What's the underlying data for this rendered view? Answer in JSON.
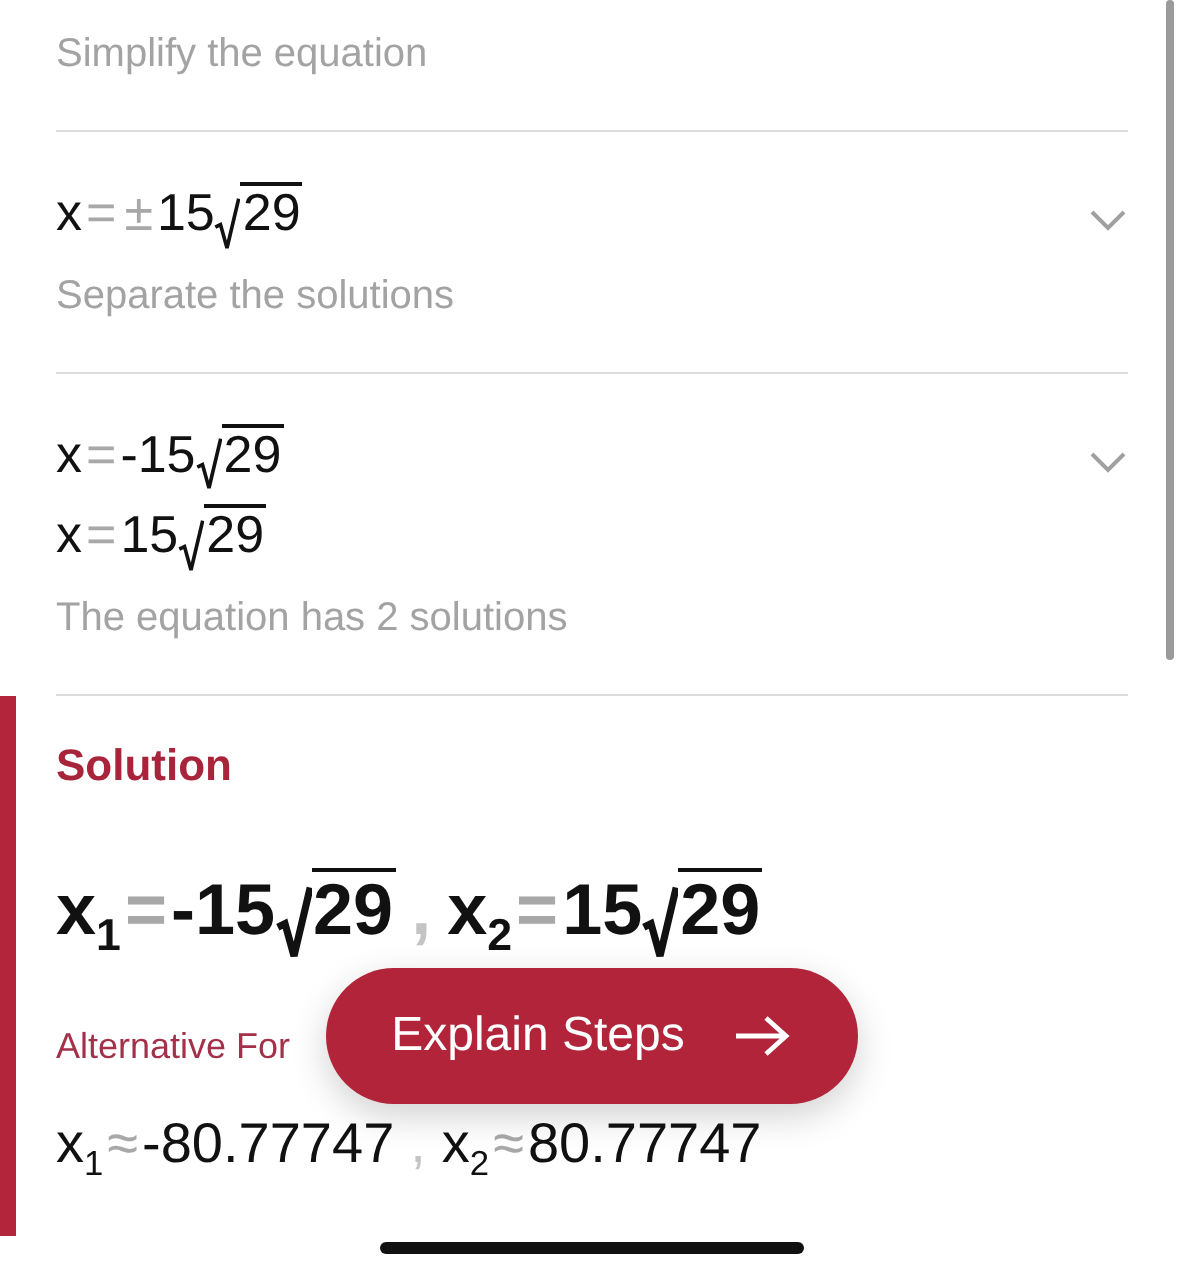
{
  "steps": [
    {
      "caption": "Simplify the equation"
    },
    {
      "expressions": [
        [
          {
            "kind": "var",
            "text": "x"
          },
          {
            "kind": "op",
            "text": "="
          },
          {
            "kind": "op",
            "text": "±"
          },
          {
            "kind": "num",
            "text": "15"
          },
          {
            "kind": "sqrt",
            "text": "29"
          }
        ]
      ],
      "caption": "Separate the solutions",
      "expanded": false
    },
    {
      "expressions": [
        [
          {
            "kind": "var",
            "text": "x"
          },
          {
            "kind": "op",
            "text": "="
          },
          {
            "kind": "num",
            "text": "-15"
          },
          {
            "kind": "sqrt",
            "text": "29"
          }
        ],
        [
          {
            "kind": "var",
            "text": "x"
          },
          {
            "kind": "op",
            "text": "="
          },
          {
            "kind": "num",
            "text": "15"
          },
          {
            "kind": "sqrt",
            "text": "29"
          }
        ]
      ],
      "caption": "The equation has 2 solutions",
      "expanded": false
    }
  ],
  "solution": {
    "title": "Solution",
    "expression": [
      {
        "kind": "var",
        "text": "x",
        "sub": "1"
      },
      {
        "kind": "op",
        "text": "="
      },
      {
        "kind": "num",
        "text": "-15"
      },
      {
        "kind": "sqrt",
        "text": "29"
      },
      {
        "kind": "sep",
        "text": ","
      },
      {
        "kind": "var",
        "text": "x",
        "sub": "2"
      },
      {
        "kind": "op",
        "text": "="
      },
      {
        "kind": "num",
        "text": "15"
      },
      {
        "kind": "sqrt",
        "text": "29"
      }
    ],
    "alternative_label": "Alternative For",
    "alternative": [
      {
        "kind": "var",
        "text": "x",
        "sub": "1"
      },
      {
        "kind": "op",
        "text": "≈"
      },
      {
        "kind": "num",
        "text": "-80.77747"
      },
      {
        "kind": "sep",
        "text": ","
      },
      {
        "kind": "var",
        "text": "x",
        "sub": "2"
      },
      {
        "kind": "op",
        "text": "≈"
      },
      {
        "kind": "num",
        "text": "80.77747"
      }
    ]
  },
  "explain_button": {
    "label": "Explain Steps"
  }
}
